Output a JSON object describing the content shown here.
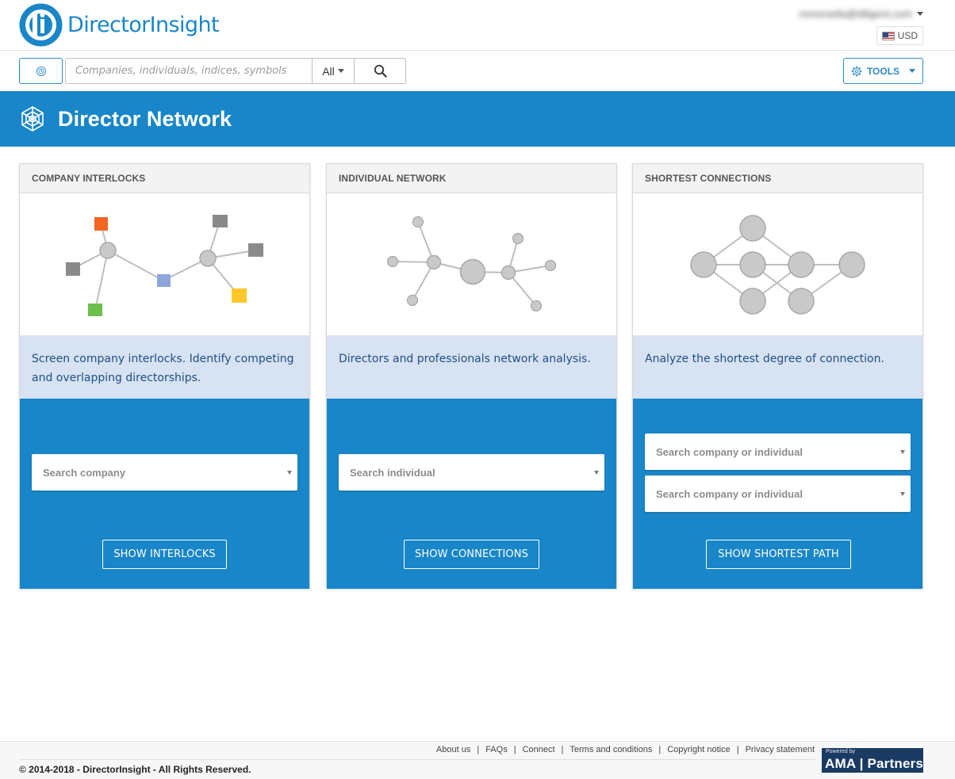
{
  "header": {
    "brand": "DirectorInsight",
    "user_email": "mmorsella@diligent.com",
    "currency": "USD"
  },
  "search": {
    "placeholder": "Companies, individuals, indices, symbols",
    "scope": "All",
    "tools_label": "TOOLS"
  },
  "banner": {
    "title": "Director Network"
  },
  "cards": [
    {
      "title": "COMPANY INTERLOCKS",
      "description": "Screen company interlocks. Identify competing and overlapping directorships.",
      "selects": [
        "Search company"
      ],
      "button": "SHOW INTERLOCKS"
    },
    {
      "title": "INDIVIDUAL NETWORK",
      "description": "Directors and professionals network analysis.",
      "selects": [
        "Search individual"
      ],
      "button": "SHOW CONNECTIONS"
    },
    {
      "title": "SHORTEST CONNECTIONS",
      "description": "Analyze the shortest degree of connection.",
      "selects": [
        "Search company or individual",
        "Search company or individual"
      ],
      "button": "SHOW SHORTEST PATH"
    }
  ],
  "footer": {
    "links": [
      "About us",
      "FAQs",
      "Connect",
      "Terms and conditions",
      "Copyright notice",
      "Privacy statement"
    ],
    "copyright": "© 2014-2018 - DirectorInsight - All Rights Reserved.",
    "badge_small": "Powered by",
    "badge_big": "AMA | Partners"
  },
  "colors": {
    "brand_blue": "#1886c8",
    "desc_bg": "#d7e2f2",
    "node_gray": "#c9c9c9",
    "orange": "#f26522",
    "periwinkle": "#8fa6dc",
    "green": "#6cc04a",
    "yellow": "#ffc72c"
  },
  "icons": [
    "logo-mark-icon",
    "recent-icon",
    "search-icon",
    "gear-icon",
    "network-web-icon",
    "chevron-down-icon"
  ]
}
